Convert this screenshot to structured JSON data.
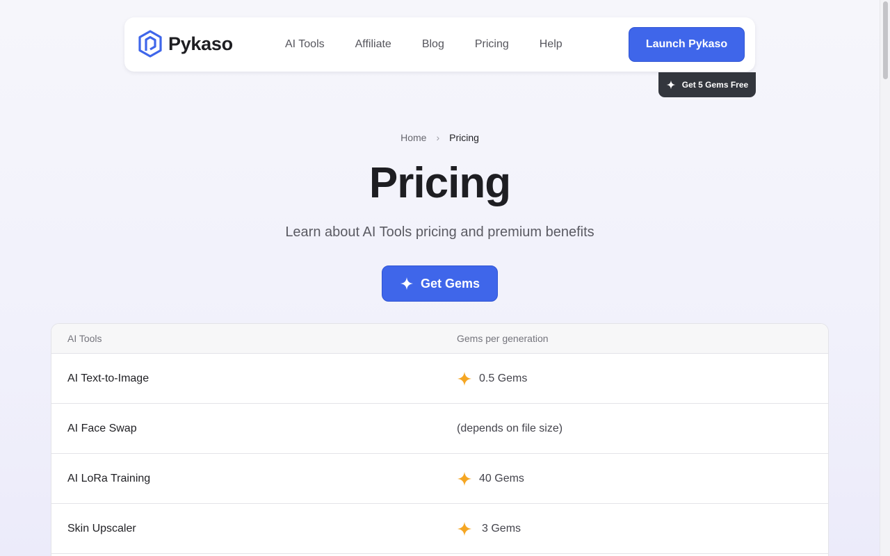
{
  "header": {
    "logo_text": "Pykaso",
    "nav": [
      "AI Tools",
      "Affiliate",
      "Blog",
      "Pricing",
      "Help"
    ],
    "launch_label": "Launch Pykaso",
    "gems_free_label": "Get 5 Gems Free"
  },
  "breadcrumb": {
    "home": "Home",
    "separator": "›",
    "current": "Pricing"
  },
  "page": {
    "title": "Pricing",
    "subtitle": "Learn about AI Tools pricing and premium benefits",
    "get_gems_label": "Get Gems"
  },
  "table": {
    "headers": {
      "tool": "AI Tools",
      "gems": "Gems per generation"
    },
    "rows": [
      {
        "name": "AI Text-to-Image",
        "gems": "0.5 Gems",
        "icon": "gem-icon"
      },
      {
        "name": "AI Face Swap",
        "gems": "(depends on file size)",
        "icon": ""
      },
      {
        "name": "AI LoRa Training",
        "gems": "40 Gems",
        "icon": "gem-icon"
      },
      {
        "name": "Skin Upscaler",
        "gems": "3 Gems",
        "icon": "gem-icon"
      }
    ]
  },
  "colors": {
    "accent": "#3f66ea",
    "gem": "#f5a623",
    "dark_badge": "#33363d"
  }
}
